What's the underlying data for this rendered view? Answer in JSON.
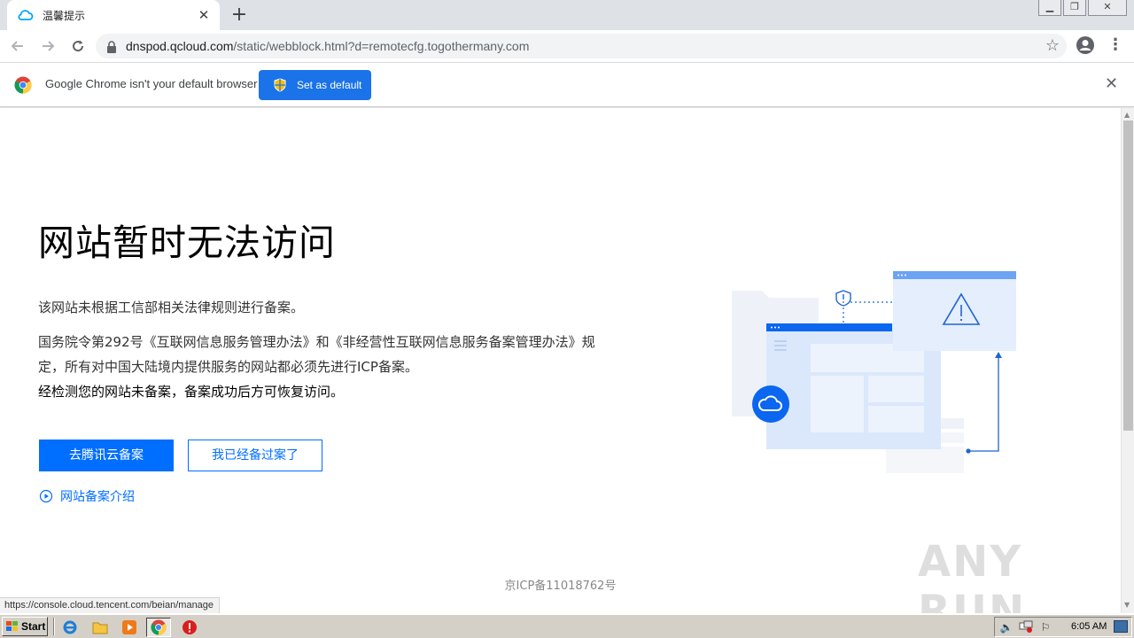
{
  "browser": {
    "tab_title": "温馨提示",
    "url_host": "dnspod.qcloud.com",
    "url_path": "/static/webblock.html?d=remotecfg.togothermany.com",
    "new_tab_symbol": "+",
    "tab_close_symbol": "✕"
  },
  "infobar": {
    "message": "Google Chrome isn't your default browser",
    "button": "Set as default"
  },
  "page": {
    "heading": "网站暂时无法访问",
    "para1": "该网站未根据工信部相关法律规则进行备案。",
    "para2": "国务院令第292号《互联网信息服务管理办法》和《非经营性互联网信息服务备案管理办法》规定，所有对中国大陆境内提供服务的网站都必须先进行ICP备案。",
    "para3": "经检测您的网站未备案，备案成功后方可恢复访问。",
    "primary_button": "去腾讯云备案",
    "secondary_button": "我已经备过案了",
    "intro_link": "网站备案介绍",
    "icp": "京ICP备11018762号",
    "accent_color": "#006eff"
  },
  "status_url": "https://console.cloud.tencent.com/beian/manage",
  "watermark": "ANY RUN",
  "taskbar": {
    "start": "Start",
    "clock": "6:05 AM"
  }
}
